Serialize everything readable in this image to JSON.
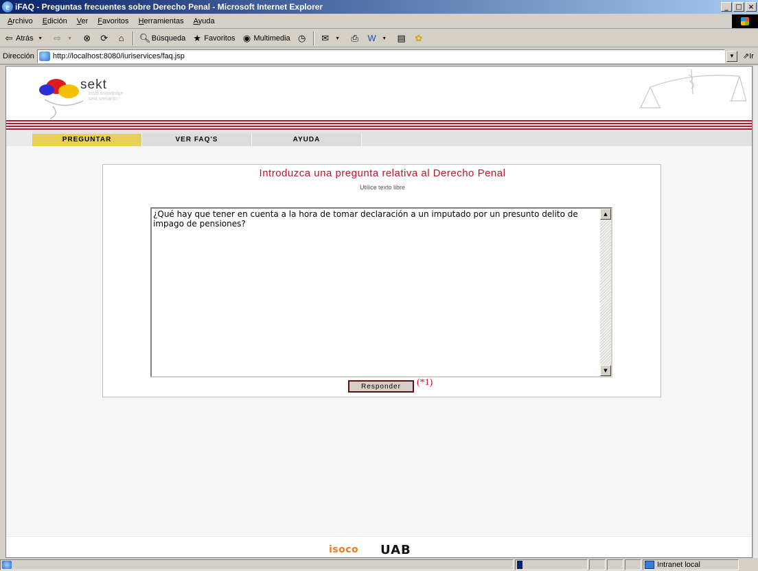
{
  "window": {
    "title": "iFAQ - Preguntas frecuentes sobre Derecho Penal - Microsoft Internet Explorer",
    "controls": [
      "_",
      "□",
      "×"
    ]
  },
  "menu": [
    "Archivo",
    "Edición",
    "Ver",
    "Favoritos",
    "Herramientas",
    "Ayuda"
  ],
  "toolbar": {
    "back": "Atrás",
    "search": "Búsqueda",
    "favorites": "Favoritos",
    "media": "Multimedia"
  },
  "address": {
    "label": "Dirección",
    "url": "http://localhost:8080/iuriservices/faq.jsp",
    "go": "Ir"
  },
  "logo": {
    "word": "sekt",
    "tagline1": "taste knowledge",
    "tagline2": "sekt.semantic"
  },
  "nav": {
    "tabs": [
      "PREGUNTAR",
      "VER FAQ'S",
      "AYUDA"
    ]
  },
  "form": {
    "title": "Introduzca una pregunta relativa al Derecho Penal",
    "subtitle": "Utilice texto libre",
    "question": "¿Qué hay que tener en cuenta a la hora de tomar declaración a un imputado por un presunto delito de impago de pensiones?",
    "submit": "Responder",
    "note": "(*1)"
  },
  "footer": {
    "left_logo": "isoco",
    "right_logo": "UAB"
  },
  "status": {
    "zone": "Intranet local"
  },
  "colors": {
    "accent_red": "#c4102a",
    "tab_active": "#e8cf56",
    "titlebar": "#0a246a"
  }
}
